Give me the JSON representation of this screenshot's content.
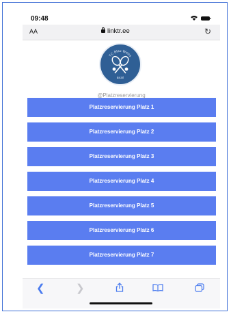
{
  "status_bar": {
    "time": "09:48"
  },
  "address_bar": {
    "text_size_label": "AA",
    "url": "linktr.ee"
  },
  "profile": {
    "logo_text_top": "TC Blau-Weiss",
    "logo_text_bottom": "Brühl",
    "handle": "@Platzreservierung"
  },
  "links": [
    {
      "label": "Platzreservierung Platz 1"
    },
    {
      "label": "Platzreservierung Platz 2"
    },
    {
      "label": "Platzreservierung Platz 3"
    },
    {
      "label": "Platzreservierung Platz 4"
    },
    {
      "label": "Platzreservierung Platz 5"
    },
    {
      "label": "Platzreservierung Platz 6"
    },
    {
      "label": "Platzreservierung Platz 7"
    }
  ],
  "toolbar": {
    "back_icon": "chevron-left-icon",
    "forward_icon": "chevron-right-icon",
    "share_icon": "share-icon",
    "bookmarks_icon": "book-icon",
    "tabs_icon": "tabs-icon"
  },
  "colors": {
    "button": "#5a7df0",
    "logo": "#2f5f95",
    "accent": "#4a7bef"
  }
}
